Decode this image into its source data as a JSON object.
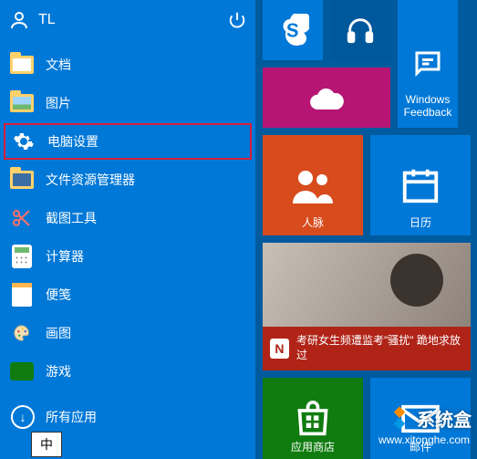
{
  "user": {
    "name": "TL"
  },
  "menu": [
    {
      "key": "documents",
      "label": "文档"
    },
    {
      "key": "pictures",
      "label": "图片"
    },
    {
      "key": "settings",
      "label": "电脑设置",
      "highlight": true
    },
    {
      "key": "explorer",
      "label": "文件资源管理器"
    },
    {
      "key": "snip",
      "label": "截图工具"
    },
    {
      "key": "calc",
      "label": "计算器"
    },
    {
      "key": "notes",
      "label": "便笺"
    },
    {
      "key": "paint",
      "label": "画图"
    },
    {
      "key": "games",
      "label": "游戏"
    }
  ],
  "all_apps_label": "所有应用",
  "ime": "中",
  "tiles": {
    "row0": {
      "skype": "",
      "music": "",
      "feedback": "Windows\nFeedback"
    },
    "row1": {
      "onedrive": ""
    },
    "row2": {
      "people": "人脉",
      "calendar": "日历"
    },
    "news": {
      "icon": "N",
      "text": "考研女生频遭监考\"骚扰\" 跪地求放过"
    },
    "row4": {
      "store": "应用商店",
      "mail": "邮件"
    }
  },
  "watermark": {
    "brand": "系统盒",
    "url": "www.xitonghe.com"
  },
  "colors": {
    "panel": "#0078d7",
    "accent_highlight": "#d61f3a",
    "magenta": "#b61573",
    "orange": "#d84b1d",
    "green": "#107c10",
    "red": "#b02418"
  }
}
